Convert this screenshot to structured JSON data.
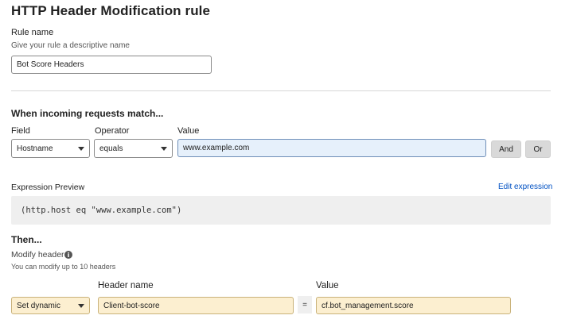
{
  "page": {
    "title": "HTTP Header Modification rule"
  },
  "rule_name": {
    "label": "Rule name",
    "hint": "Give your rule a descriptive name",
    "value": "Bot Score Headers"
  },
  "match": {
    "heading": "When incoming requests match...",
    "field_label": "Field",
    "operator_label": "Operator",
    "value_label": "Value",
    "field_value": "Hostname",
    "operator_value": "equals",
    "value_value": "www.example.com",
    "and_label": "And",
    "or_label": "Or"
  },
  "expression": {
    "label": "Expression Preview",
    "edit_link": "Edit expression",
    "code": "(http.host eq \"www.example.com\")"
  },
  "then": {
    "heading": "Then...",
    "modify_label": "Modify header",
    "info_icon": "i",
    "modify_hint": "You can modify up to 10 headers",
    "header_name_label": "Header name",
    "value_label": "Value",
    "action_value": "Set dynamic",
    "header_name_value": "Client-bot-score",
    "equals_sign": "=",
    "value_value": "cf.bot_management.score"
  },
  "colors": {
    "link": "#0051c3",
    "highlight_yellow": "#fcefd0",
    "focus_blue": "#e6f0fb"
  }
}
